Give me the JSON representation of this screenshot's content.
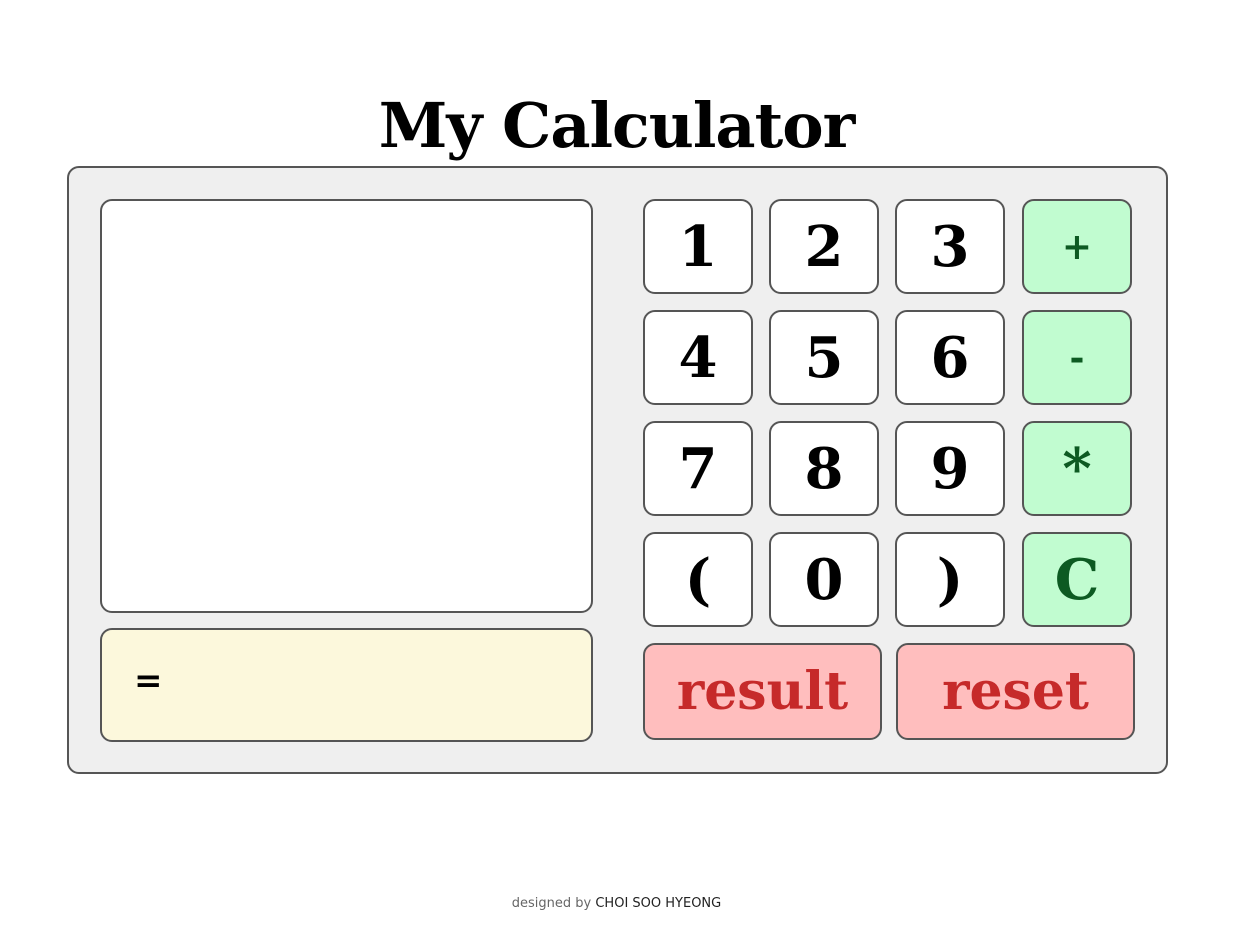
{
  "title": "My Calculator",
  "display": {
    "expression": ""
  },
  "result": {
    "equals_label": "=",
    "value": ""
  },
  "keys": {
    "k1": "1",
    "k2": "2",
    "k3": "3",
    "plus": "+",
    "k4": "4",
    "k5": "5",
    "k6": "6",
    "minus": "-",
    "k7": "7",
    "k8": "8",
    "k9": "9",
    "multiply": "*",
    "lparen": "(",
    "k0": "0",
    "rparen": ")",
    "clear": "C",
    "result_btn": "result",
    "reset_btn": "reset"
  },
  "footer": {
    "prefix": "designed by",
    "author": "CHOI SOO HYEONG"
  },
  "colors": {
    "panel_bg": "#efefef",
    "operator_bg": "#c1fcd0",
    "operator_text": "#0d5a22",
    "action_bg": "#ffbebe",
    "action_text": "#c62a2a",
    "result_bg": "#fcf8dc"
  }
}
